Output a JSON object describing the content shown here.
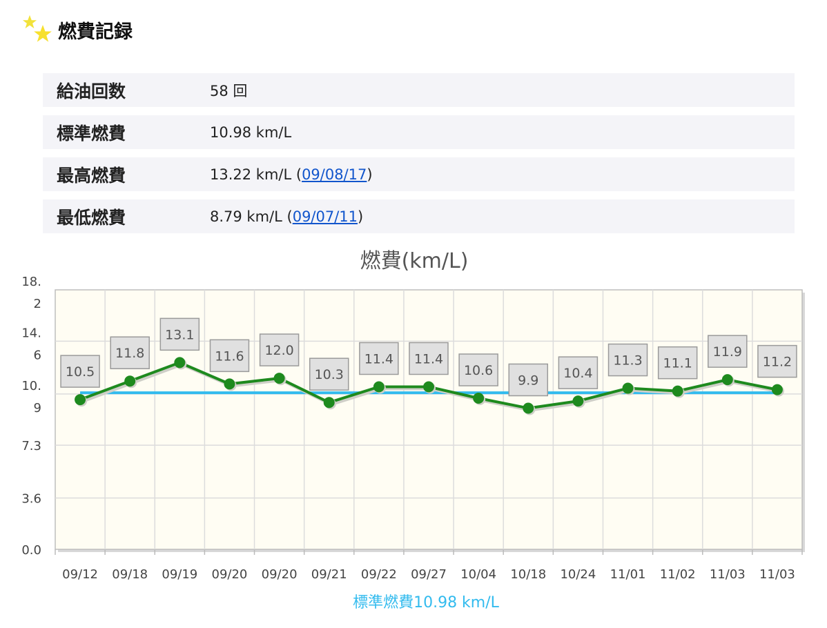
{
  "header": {
    "title": "燃費記録",
    "icon": "stars-icon"
  },
  "stats": [
    {
      "label": "給油回数",
      "value": "58 回",
      "link": null,
      "suffix": null
    },
    {
      "label": "標準燃費",
      "value": "10.98 km/L",
      "link": null,
      "suffix": null
    },
    {
      "label": "最高燃費",
      "value": "13.22 km/L (",
      "link": "09/08/17",
      "suffix": ")"
    },
    {
      "label": "最低燃費",
      "value": "8.79 km/L (",
      "link": "09/07/11",
      "suffix": ")"
    }
  ],
  "chart_data": {
    "type": "line",
    "title": "燃費(km/L)",
    "categories": [
      "09/12",
      "09/18",
      "09/19",
      "09/20",
      "09/20",
      "09/21",
      "09/22",
      "09/27",
      "10/04",
      "10/18",
      "10/24",
      "11/01",
      "11/02",
      "11/03",
      "11/03"
    ],
    "series": [
      {
        "values": [
          10.5,
          11.8,
          13.1,
          11.6,
          12.0,
          10.3,
          11.4,
          11.4,
          10.6,
          9.9,
          10.4,
          11.3,
          11.1,
          11.9,
          11.2
        ],
        "color": "#1e8a1e"
      }
    ],
    "data_labels": [
      "10.5",
      "11.8",
      "13.1",
      "11.6",
      "12.0",
      "10.3",
      "11.4",
      "11.4",
      "10.6",
      "9.9",
      "10.4",
      "11.3",
      "11.1",
      "11.9",
      "11.2"
    ],
    "reference_line": {
      "label": "標準燃費10.98 km/L",
      "value": 10.98,
      "color": "#33bbee"
    },
    "yticks": [
      {
        "value": 0,
        "lines": [
          "0.0"
        ]
      },
      {
        "value": 3.6,
        "lines": [
          "3.6"
        ]
      },
      {
        "value": 7.3,
        "lines": [
          "7.3"
        ]
      },
      {
        "value": 10.9,
        "lines": [
          "10.",
          "9"
        ]
      },
      {
        "value": 14.6,
        "lines": [
          "14.",
          "6"
        ]
      },
      {
        "value": 18.2,
        "lines": [
          "18.",
          "2"
        ]
      }
    ],
    "ylim": [
      0,
      18.2
    ],
    "grid": true,
    "background": "#fffdf3"
  }
}
